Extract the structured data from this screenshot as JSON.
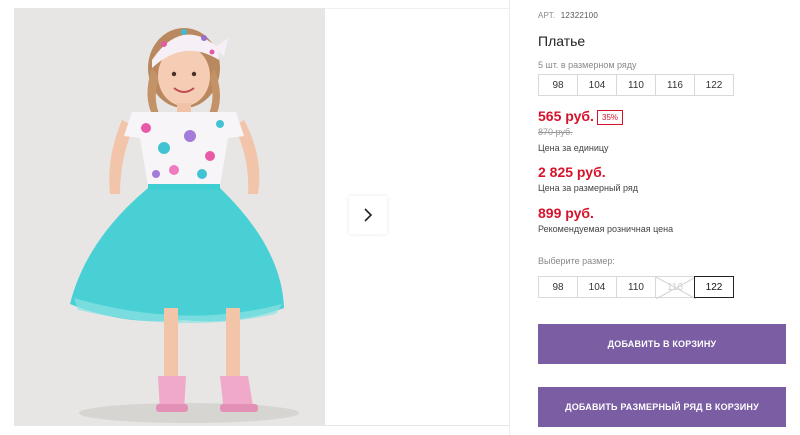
{
  "product": {
    "article_label": "АРТ.",
    "article_value": "12322100",
    "title": "Платье"
  },
  "size_row": {
    "note": "5 шт. в размерном ряду",
    "sizes": [
      "98",
      "104",
      "110",
      "116",
      "122"
    ]
  },
  "prices": {
    "unit_price": "565 руб.",
    "discount": "35%",
    "old_price": "870 руб.",
    "unit_label": "Цена за единицу",
    "row_price": "2 825 руб.",
    "row_label": "Цена за размерный ряд",
    "retail_price": "899 руб.",
    "retail_label": "Рекомендуемая розничная цена"
  },
  "size_select": {
    "label": "Выберите размер:",
    "sizes": [
      "98",
      "104",
      "110",
      "116",
      "122"
    ],
    "selected": "122",
    "unavailable": "116"
  },
  "buttons": {
    "add_to_cart": "ДОБАВИТЬ В КОРЗИНУ",
    "add_row_to_cart": "ДОБАВИТЬ РАЗМЕРНЫЙ РЯД В КОРЗИНУ"
  },
  "colors": {
    "price_red": "#d6132b",
    "button_purple": "#7a5da3",
    "dress_tulle": "#3fcfd3"
  },
  "icons": {
    "next_arrow": "chevron-right-icon"
  }
}
